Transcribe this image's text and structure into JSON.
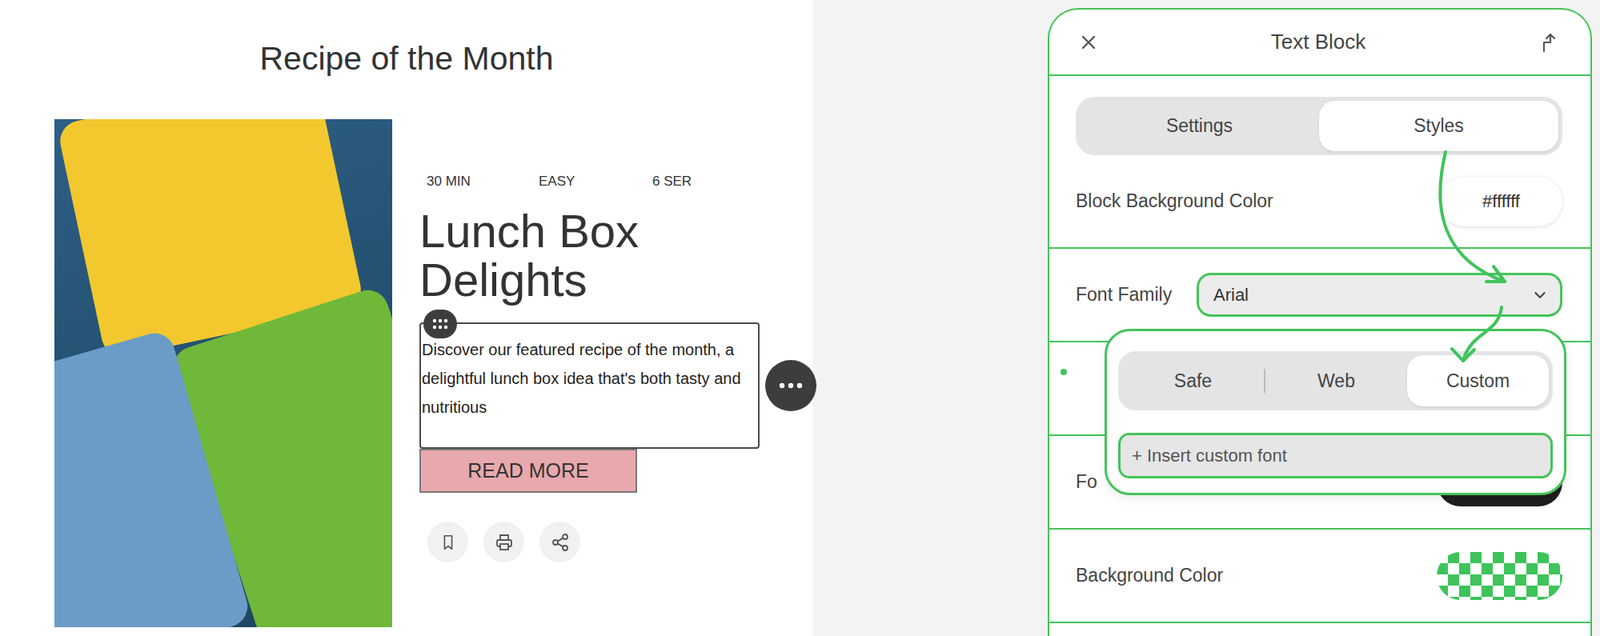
{
  "recipe_section": {
    "title": "Recipe of the Month",
    "meta": [
      "30 MIN",
      "EASY",
      "6 SER"
    ],
    "recipe_title": "Lunch Box Delights",
    "description": "Discover our featured recipe of the month, a delightful lunch box idea that's both tasty and nutritious",
    "button": "READ MORE"
  },
  "panel": {
    "title": "Text Block",
    "tabs": [
      {
        "label": "Settings",
        "selected": false
      },
      {
        "label": "Styles",
        "selected": true
      }
    ],
    "rows": [
      {
        "label": "Block Background Color",
        "kind": "text-value",
        "value": "#ffffff"
      },
      {
        "label": "Font Family",
        "kind": "select",
        "value": "Arial",
        "open": true
      },
      {
        "kind": "marker"
      },
      {
        "label": "Fo",
        "kind": "swatch",
        "color": "#1e1e1e"
      },
      {
        "label": "Background Color",
        "kind": "checker",
        "color": "#3ec45a"
      }
    ]
  },
  "font_dropdown": {
    "tabs": [
      {
        "label": "Safe",
        "selected": false
      },
      {
        "label": "Web",
        "selected": false
      },
      {
        "label": "Custom",
        "selected": true
      }
    ],
    "action": "+ Insert custom font"
  }
}
